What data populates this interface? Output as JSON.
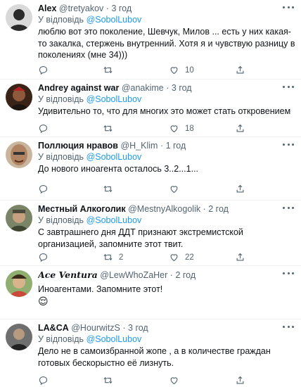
{
  "reply_prefix": "У відповідь",
  "dot": "·",
  "tweets": [
    {
      "name": "Alex",
      "handle": "@tretyakov",
      "time": "3 год",
      "reply_to": "@SobolLubov",
      "text": "люблю вот это поколение, Шевчук, Милов ... есть у них какая-то закалка, стержень внутренний. Хотя я и чувствую разницу в поколениях (мне 34)))",
      "retweets": "",
      "likes": "10",
      "avatar_color": "#2b2b2b"
    },
    {
      "name": "Andrey against war",
      "handle": "@anakime",
      "time": "3 год",
      "reply_to": "@SobolLubov",
      "text": "Удивительно то, что для многих это может стать откровением",
      "retweets": "",
      "likes": "18",
      "avatar_color": "#4a2a1e"
    },
    {
      "name": "Поллюция нравов",
      "handle": "@H_Klim",
      "time": "1 год",
      "reply_to": "@SobolLubov",
      "text": "До нового иноагента осталось 3..2...1...",
      "retweets": "",
      "likes": "",
      "avatar_color": "#8a6a52"
    },
    {
      "name": "Местный Алкоголик",
      "handle": "@MestnyAlkogolik",
      "time": "2 год",
      "reply_to": "@SobolLubov",
      "text": "С завтрашнего дня ДДТ признают экстремистской организацией, запомните этот твит.",
      "retweets": "2",
      "likes": "22",
      "avatar_color": "#5d6a4a"
    },
    {
      "name": "Ace Ventura",
      "handle": "@LewWhoZaHer",
      "time": "2 год",
      "reply_to": "",
      "text": "Иноагентами. Запомните этот!",
      "emoji": "😌",
      "retweets": "",
      "likes": "",
      "avatar_color": "#6d8a5a"
    },
    {
      "name": "LA&CA",
      "handle": "@HourwitzS",
      "time": "3 год",
      "reply_to": "@SobolLubov",
      "text": "Дело не в самоизбранной жопе , а в количестве граждан готовых бескорыстно её лизнуть.",
      "retweets": "",
      "likes": "",
      "avatar_color": "#3a3a3a"
    }
  ],
  "icons": {
    "reply": "reply-icon",
    "retweet": "retweet-icon",
    "like": "heart-icon",
    "share": "share-icon",
    "more": "more-icon"
  },
  "colors": {
    "link": "#1d9bf0",
    "muted": "#536471",
    "text": "#0f1419",
    "divider": "#eff3f4"
  }
}
